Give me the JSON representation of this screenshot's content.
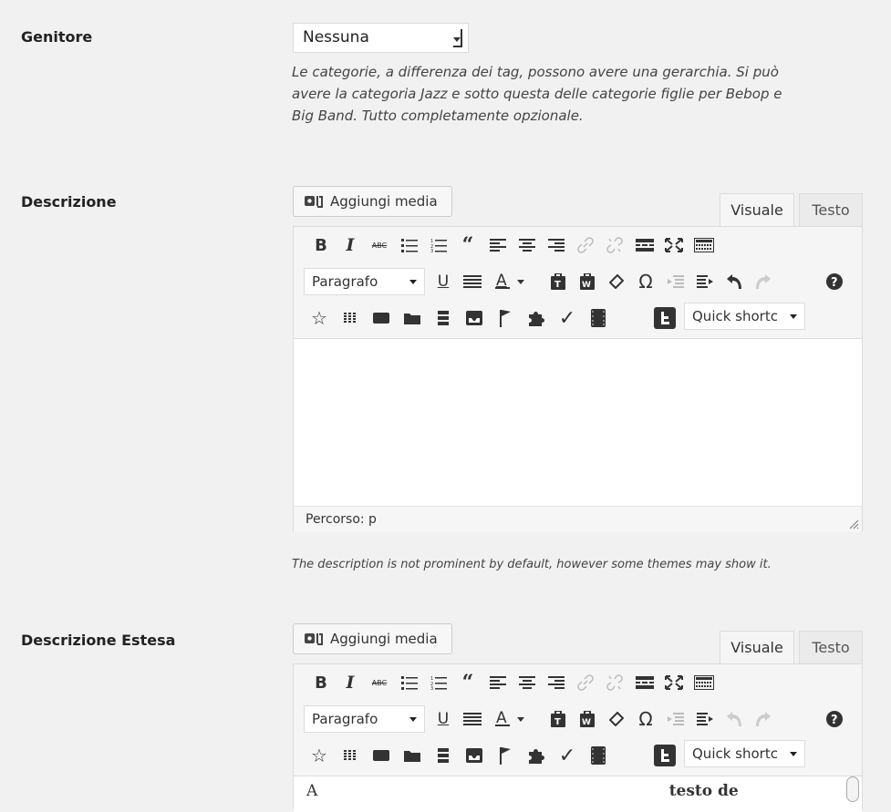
{
  "parent": {
    "label": "Genitore",
    "selected": "Nessuna",
    "help": [
      "Le categorie, a differenza dei tag, possono avere una gerarchia. Si può",
      "avere la categoria Jazz e sotto questa delle categorie figlie per Bebop e",
      "Big Band. Tutto completamente opzionale."
    ]
  },
  "description": {
    "label": "Descrizione",
    "add_media": "Aggiungi media",
    "tab_visual": "Visuale",
    "tab_text": "Testo",
    "format_select": "Paragrafo",
    "shortcode_select": "Quick shortc",
    "path": "Percorso: p",
    "help": "The description is not prominent by default, however some themes may show it."
  },
  "extended": {
    "label": "Descrizione Estesa",
    "add_media": "Aggiungi media",
    "tab_visual": "Visuale",
    "tab_text": "Testo",
    "format_select": "Paragrafo",
    "shortcode_select": "Quick shortc",
    "content_preview_normal": "A",
    "content_preview_bold": "testo de"
  },
  "toolbar_icons": {
    "row1": [
      "bold-icon",
      "italic-icon",
      "strikethrough-icon",
      "bullet-list-icon",
      "numbered-list-icon",
      "blockquote-icon",
      "align-left-icon",
      "align-center-icon",
      "align-right-icon",
      "link-icon",
      "unlink-icon",
      "read-more-icon",
      "fullscreen-icon",
      "toolbar-toggle-icon"
    ],
    "row2": [
      "underline-icon",
      "justify-icon",
      "text-color-icon",
      "paste-text-icon",
      "clear-formatting-icon",
      "eraser-icon",
      "special-char-icon",
      "outdent-icon",
      "indent-icon",
      "undo-icon",
      "redo-icon",
      "help-icon"
    ],
    "row3": [
      "star-icon",
      "columns-icon",
      "box-icon",
      "folder-icon",
      "list-icon",
      "inbox-icon",
      "flag-icon",
      "puzzle-icon",
      "checkmark-icon",
      "film-icon",
      "twitter-icon"
    ]
  }
}
